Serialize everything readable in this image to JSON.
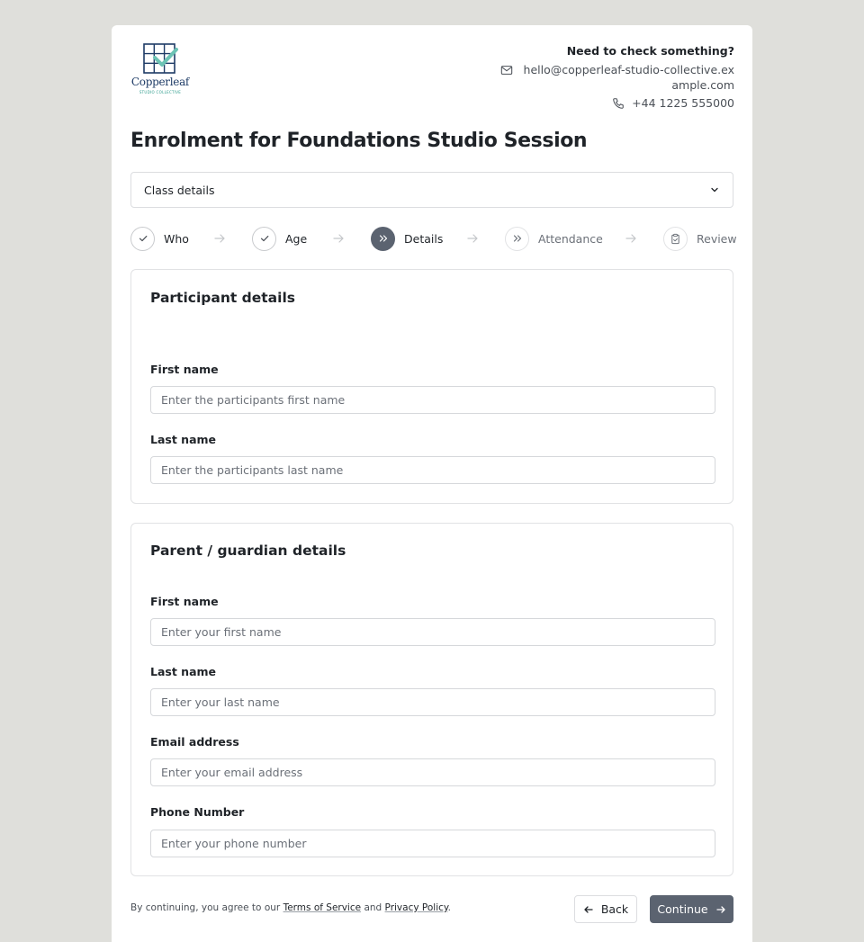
{
  "brand": {
    "name": "Copperleaf",
    "tagline": "STUDIO COLLECTIVE",
    "primary_color": "#1e3b66",
    "accent_color": "#6cc3b4"
  },
  "contact": {
    "heading": "Need to check something?",
    "email": "hello@copperleaf-studio-collective.example.com",
    "phone": "+44 1225 555000",
    "email_icon": "mail-icon",
    "phone_icon": "phone-icon"
  },
  "page_title": "Enrolment for Foundations Studio Session",
  "accordion": {
    "label": "Class details",
    "icon": "chevron-down-icon"
  },
  "stepper": {
    "steps": [
      {
        "label": "Who",
        "state": "complete",
        "icon": "check-icon"
      },
      {
        "label": "Age",
        "state": "complete",
        "icon": "check-icon"
      },
      {
        "label": "Details",
        "state": "current",
        "icon": "chevrons-right-icon"
      },
      {
        "label": "Attendance",
        "state": "upcoming",
        "icon": "chevrons-right-icon"
      },
      {
        "label": "Review",
        "state": "upcoming",
        "icon": "clipboard-check-icon"
      }
    ],
    "active_color": "#5b6370"
  },
  "participant": {
    "title": "Participant details",
    "first_name": {
      "label": "First name",
      "placeholder": "Enter the participants first name",
      "value": ""
    },
    "last_name": {
      "label": "Last name",
      "placeholder": "Enter the participants last name",
      "value": ""
    }
  },
  "guardian": {
    "title": "Parent / guardian details",
    "first_name": {
      "label": "First name",
      "placeholder": "Enter your first name",
      "value": ""
    },
    "last_name": {
      "label": "Last name",
      "placeholder": "Enter your last name",
      "value": ""
    },
    "email": {
      "label": "Email address",
      "placeholder": "Enter your email address",
      "value": ""
    },
    "phone": {
      "label": "Phone Number",
      "placeholder": "Enter your phone number",
      "value": ""
    }
  },
  "footer": {
    "note_prefix": "By continuing, you agree to our",
    "terms_label": "Terms of Service",
    "and": "and",
    "privacy_label": "Privacy Policy",
    "suffix": ".",
    "back_label": "Back",
    "continue_label": "Continue"
  }
}
